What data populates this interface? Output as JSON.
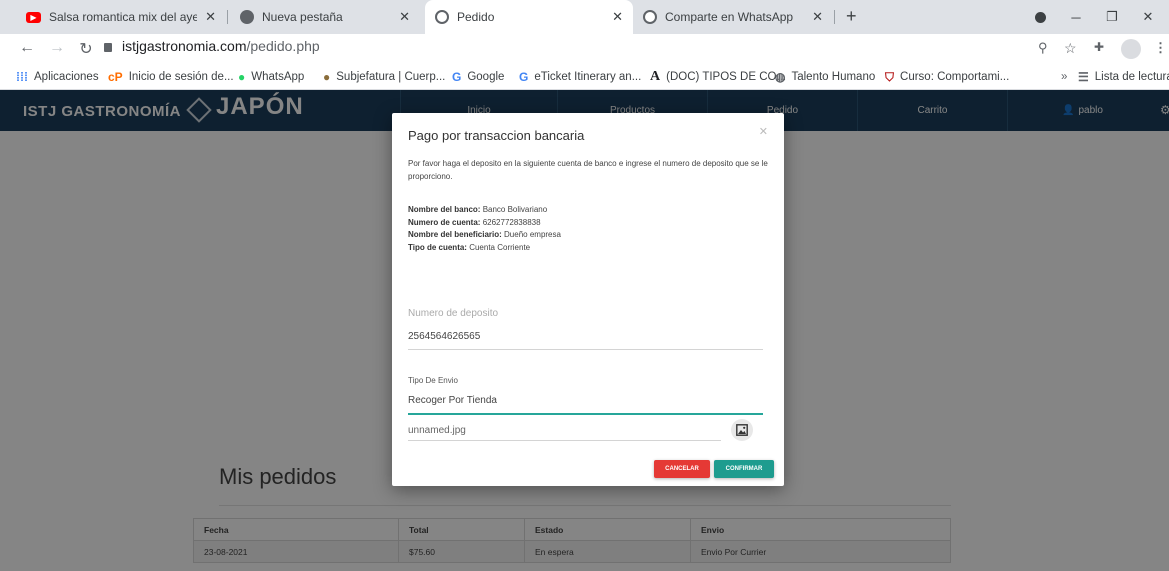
{
  "browser": {
    "tabs": [
      {
        "title": "Salsa romantica mix del ayer y hc",
        "favicon": "youtube-icon",
        "color": "#ff0000"
      },
      {
        "title": "Nueva pestaña",
        "favicon": "chrome-icon",
        "color": "#5f6368"
      },
      {
        "title": "Pedido",
        "favicon": "globe-icon",
        "color": "#5f6368"
      },
      {
        "title": "Comparte en WhatsApp",
        "favicon": "globe-icon",
        "color": "#5f6368"
      }
    ],
    "url_host": "istjgastronomia.com",
    "url_path": "/pedido.php",
    "bookmarks": [
      {
        "label": "Aplicaciones",
        "icon": "apps-grid-icon",
        "color": "#4285f4"
      },
      {
        "label": "Inicio de sesión de...",
        "icon": "cp-icon",
        "color": "#ff6d00"
      },
      {
        "label": "WhatsApp",
        "icon": "whatsapp-icon",
        "color": "#25d366"
      },
      {
        "label": "Subjefatura | Cuerp...",
        "icon": "shield-icon",
        "color": "#8a6d3b"
      },
      {
        "label": "Google",
        "icon": "google-icon",
        "color": "#4285f4"
      },
      {
        "label": "eTicket Itinerary an...",
        "icon": "google-icon",
        "color": "#4285f4"
      },
      {
        "label": "(DOC) TIPOS DE CO...",
        "icon": "academia-icon",
        "color": "#202124"
      },
      {
        "label": "Talento Humano",
        "icon": "globe-icon",
        "color": "#5f6368"
      },
      {
        "label": "Curso: Comportami...",
        "icon": "crest-icon",
        "color": "#b71c1c"
      }
    ],
    "reading_list": "Lista de lectura"
  },
  "site": {
    "brand": "ISTJ GASTRONOMÍA",
    "logo": "JAPÓN",
    "nav": [
      "Inicio",
      "Productos",
      "Pedido",
      "Carrito",
      "pablo"
    ],
    "orders_title": "Mis pedidos",
    "table": {
      "headers": [
        "Fecha",
        "Total",
        "Estado",
        "Envio"
      ],
      "rows": [
        [
          "23-08-2021",
          "$75.60",
          "En espera",
          "Envio Por Currier"
        ]
      ]
    }
  },
  "modal": {
    "title": "Pago por transaccion bancaria",
    "intro": "Por favor haga el deposito en la siguiente cuenta de banco e ingrese el numero de deposito que se le proporciono.",
    "bank_label": "Nombre del banco:",
    "bank_value": "Banco Bolivariano",
    "account_label": "Numero de cuenta:",
    "account_value": "6262772838838",
    "beneficiary_label": "Nombre del beneficiario:",
    "beneficiary_value": "Dueño empresa",
    "type_label": "Tipo de cuenta:",
    "type_value": "Cuenta Corriente",
    "deposit_placeholder": "Numero de deposito",
    "deposit_value": "2564564626565",
    "shipping_label": "Tipo De Envio",
    "shipping_value": "Recoger Por Tienda",
    "file_name": "unnamed.jpg",
    "cancel_label": "CANCELAR",
    "confirm_label": "CONFIRMAR"
  }
}
